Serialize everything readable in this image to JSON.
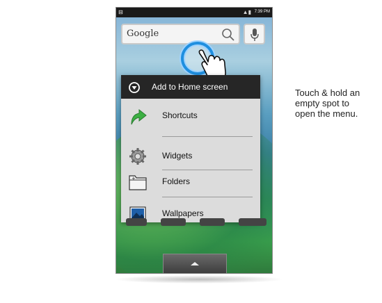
{
  "status_bar": {
    "time": "7:39 PM",
    "sd_icon": "sd-card-icon",
    "signal_icon": "signal-icon"
  },
  "search_widget": {
    "placeholder": "Google"
  },
  "menu": {
    "title": "Add to Home screen",
    "items": [
      {
        "label": "Shortcuts",
        "icon": "shortcut-arrow-icon"
      },
      {
        "label": "Widgets",
        "icon": "gear-icon"
      },
      {
        "label": "Folders",
        "icon": "folder-icon"
      },
      {
        "label": "Wallpapers",
        "icon": "wallpaper-icon"
      }
    ]
  },
  "caption": {
    "lines": [
      "Touch & hold an",
      "empty spot to",
      "open the menu."
    ]
  },
  "colors": {
    "menu_header": "#262626",
    "menu_body": "#dcdcdc",
    "touch_ring": "#1f8fe0",
    "shortcut_arrow": "#3cb043"
  }
}
